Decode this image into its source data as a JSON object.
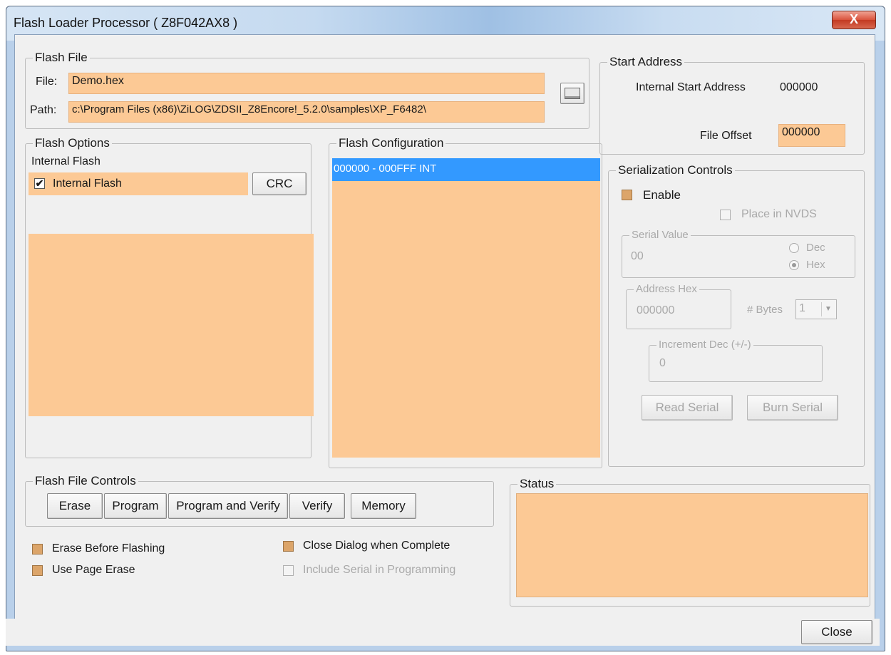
{
  "window": {
    "title": "Flash Loader Processor ( Z8F042AX8 )",
    "close_glyph": "X"
  },
  "flash_file": {
    "legend": "Flash File",
    "file_label": "File:",
    "file_value": "Demo.hex",
    "path_label": "Path:",
    "path_value": "c:\\Program Files (x86)\\ZiLOG\\ZDSII_Z8Encore!_5.2.0\\samples\\XP_F6482\\",
    "browse_icon": "folder-browse-icon"
  },
  "start_address": {
    "legend": "Start Address",
    "internal_label": "Internal Start Address",
    "internal_value": "000000",
    "offset_label": "File Offset",
    "offset_value": "000000"
  },
  "flash_options": {
    "legend": "Flash Options",
    "heading": "Internal Flash",
    "checkbox_label": "Internal Flash",
    "checked": true,
    "crc_button": "CRC"
  },
  "flash_configuration": {
    "legend": "Flash Configuration",
    "items": [
      "000000 - 000FFF INT"
    ]
  },
  "serialization": {
    "legend": "Serialization Controls",
    "enable_label": "Enable",
    "nvds_label": "Place in NVDS",
    "serial_value_legend": "Serial Value",
    "serial_value": "00",
    "dec_label": "Dec",
    "hex_label": "Hex",
    "address_hex_legend": "Address Hex",
    "address_hex_value": "000000",
    "bytes_label": "# Bytes",
    "bytes_value": "1",
    "increment_legend": "Increment Dec (+/-)",
    "increment_value": "0",
    "read_serial_button": "Read Serial",
    "burn_serial_button": "Burn Serial"
  },
  "flash_file_controls": {
    "legend": "Flash File Controls",
    "buttons": [
      "Erase",
      "Program",
      "Program and Verify",
      "Verify",
      "Memory"
    ]
  },
  "options": {
    "erase_before": "Erase Before Flashing",
    "use_page_erase": "Use Page Erase",
    "close_dialog": "Close Dialog when Complete",
    "include_serial": "Include Serial in Programming"
  },
  "status": {
    "legend": "Status"
  },
  "footer": {
    "close_button": "Close"
  },
  "colors": {
    "field": "#fcc995",
    "selection": "#3399ff",
    "dialog": "#f0f0f0"
  }
}
